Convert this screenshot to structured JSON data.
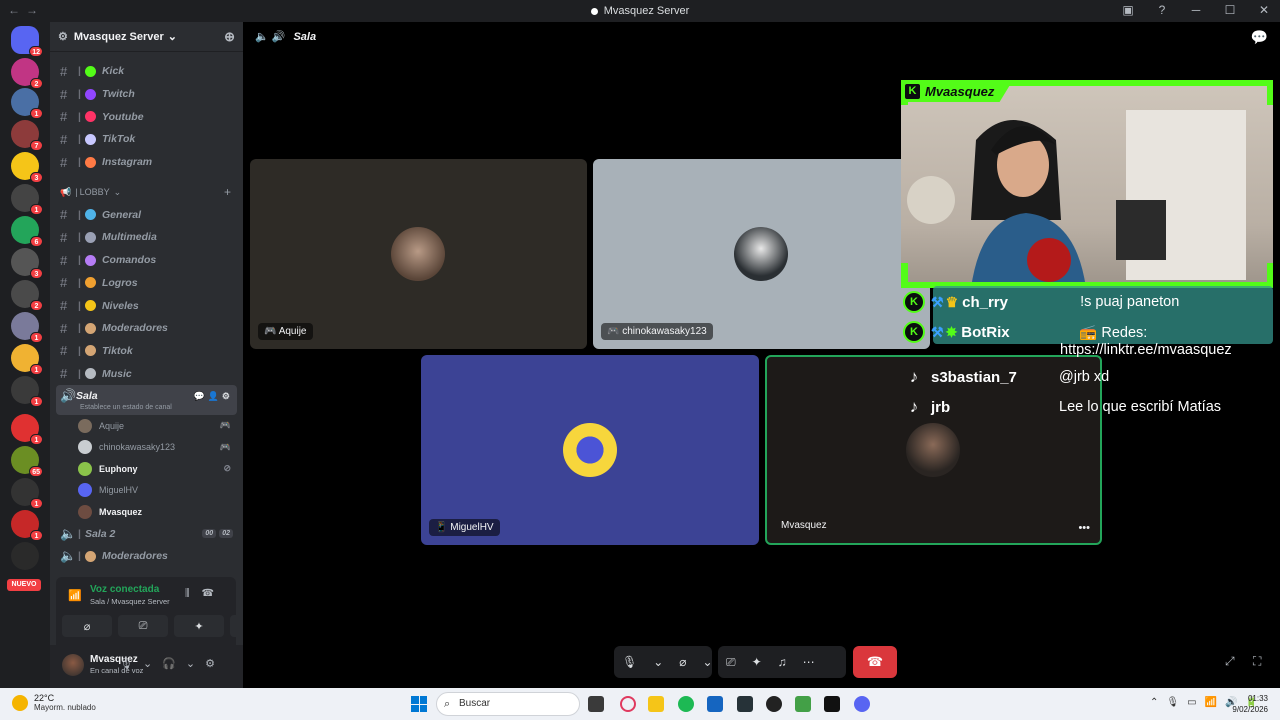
{
  "window": {
    "title": "Mvasquez Server"
  },
  "server_list": {
    "badges": [
      "12",
      "2",
      "1",
      "7",
      "3",
      "1",
      "6",
      "3",
      "2",
      "1",
      "1",
      "1",
      "1",
      "65",
      "1",
      "1"
    ],
    "nuevo_label": "NUEVO"
  },
  "sidebar": {
    "server_name": "Mvasquez Server",
    "channels_top": [
      {
        "name": "Kick",
        "color": "#53fc18"
      },
      {
        "name": "Twitch",
        "color": "#9146ff"
      },
      {
        "name": "Youtube",
        "color": "#ff3366"
      },
      {
        "name": "TikTok",
        "color": "#c8c8ff"
      },
      {
        "name": "Instagram",
        "color": "#ff7a45"
      }
    ],
    "lobby_label": "LOBBY",
    "channels_lobby": [
      {
        "name": "General",
        "color": "#4fb3e8"
      },
      {
        "name": "Multimedia",
        "color": "#9aa0b4"
      },
      {
        "name": "Comandos",
        "color": "#b57cf5"
      },
      {
        "name": "Logros",
        "color": "#f0a030"
      },
      {
        "name": "Niveles",
        "color": "#f5c518"
      },
      {
        "name": "Moderadores",
        "color": "#d4a574"
      },
      {
        "name": "Tiktok",
        "color": "#d4a574"
      },
      {
        "name": "Music",
        "color": "#b5bac1"
      }
    ],
    "active_voice": {
      "name": "Sala",
      "status": "Establece un estado de canal"
    },
    "voice_users": [
      {
        "name": "Aquije",
        "bright": false,
        "color": "#7a6b5d",
        "right": "🎮"
      },
      {
        "name": "chinokawasaky123",
        "bright": false,
        "color": "#c9cdd1",
        "right": "🎮"
      },
      {
        "name": "Euphony",
        "bright": true,
        "color": "#8bc34a",
        "right": "⊘"
      },
      {
        "name": "MiguelHV",
        "bright": false,
        "color": "#5865f2",
        "right": ""
      },
      {
        "name": "Mvasquez",
        "bright": true,
        "color": "#6d4c41",
        "right": ""
      }
    ],
    "voice2": {
      "name": "Sala 2",
      "pill1": "00",
      "pill2": "02"
    },
    "voice3": {
      "name": "Moderadores"
    }
  },
  "voice_panel": {
    "title": "Voz conectada",
    "subtitle": "Sala / Mvasquez Server"
  },
  "user": {
    "name": "Mvasquez",
    "status": "En canal de voz"
  },
  "stage": {
    "header": "Sala",
    "tiles": [
      {
        "label": "Aquije"
      },
      {
        "label": "chinokawasaky123"
      },
      {
        "label": "MiguelHV"
      },
      {
        "label": "Mvasquez"
      }
    ]
  },
  "overlay": {
    "streamer": "Mvaasquez",
    "chat": [
      {
        "platform": "kick",
        "user": "ch_rry",
        "message": "!s puaj paneton"
      },
      {
        "platform": "kick",
        "user": "BotRix",
        "message": "📻 Redes:",
        "message2": "https://linktr.ee/mvaasquez"
      },
      {
        "platform": "tiktok",
        "user": "s3bastian_7",
        "message": "@jrb xd"
      },
      {
        "platform": "tiktok",
        "user": "jrb",
        "message": "Lee lo que escribí Matías"
      }
    ]
  },
  "taskbar": {
    "temp": "22°C",
    "weather": "Mayorm. nublado",
    "search": "Buscar",
    "time": "01:33",
    "date": "9/02/2026"
  }
}
